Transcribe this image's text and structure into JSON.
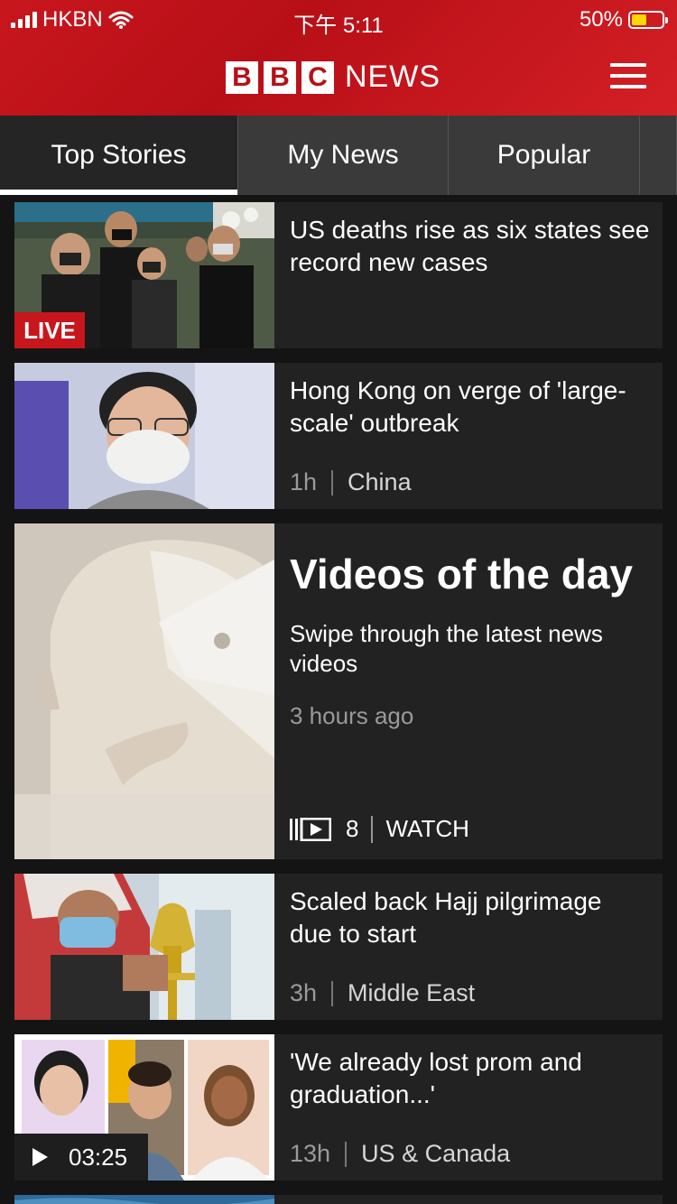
{
  "status": {
    "carrier": "HKBN",
    "time": "下午 5:11",
    "battery": "50%",
    "battery_level": 0.5
  },
  "header": {
    "logo_letters": [
      "B",
      "B",
      "C"
    ],
    "logo_word": "NEWS",
    "menu_icon": "hamburger-menu-icon"
  },
  "tabs": [
    {
      "label": "Top Stories",
      "active": true
    },
    {
      "label": "My News",
      "active": false
    },
    {
      "label": "Popular",
      "active": false
    }
  ],
  "stories": [
    {
      "headline": "US deaths rise as six states see record new cases",
      "badge": "LIVE"
    },
    {
      "headline": "Hong Kong on verge of 'large-scale' outbreak",
      "time": "1h",
      "section": "China"
    },
    {
      "title": "Videos of the day",
      "subtitle": "Swipe through the latest news videos",
      "time": "3 hours ago",
      "count": "8",
      "action": "WATCH"
    },
    {
      "headline": "Scaled back Hajj pilgrimage due to start",
      "time": "3h",
      "section": "Middle East"
    },
    {
      "headline": "'We already lost prom and graduation...'",
      "time": "13h",
      "section": "US & Canada",
      "duration": "03:25"
    }
  ],
  "colors": {
    "brand_red": "#bb1919",
    "background": "#141414",
    "card": "#222222",
    "tab_bar": "#3a3a3a",
    "battery_fill": "#ffd60a"
  }
}
